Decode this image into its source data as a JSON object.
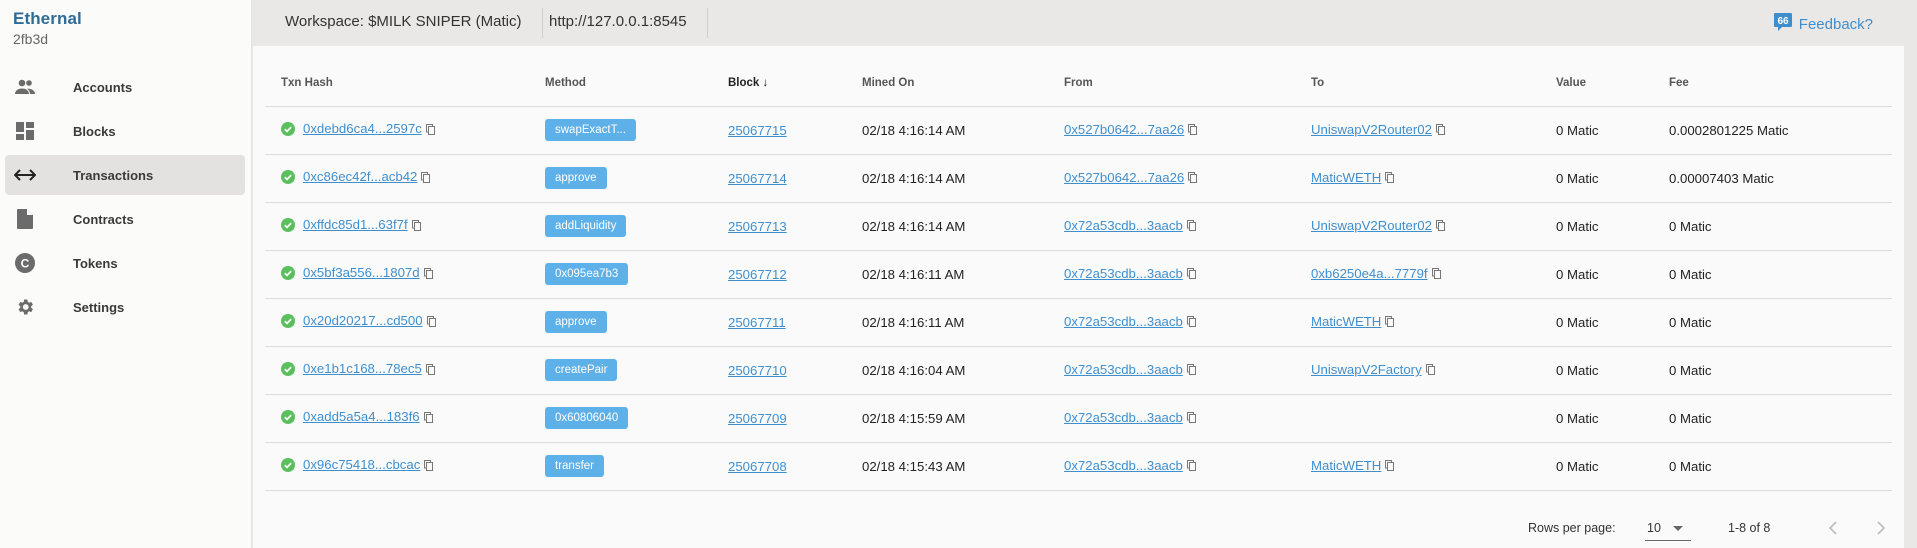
{
  "app": {
    "name": "Ethernal",
    "workspace_id": "2fb3d"
  },
  "sidebar": {
    "items": [
      {
        "label": "Accounts",
        "icon": "accounts-icon",
        "active": false
      },
      {
        "label": "Blocks",
        "icon": "blocks-icon",
        "active": false
      },
      {
        "label": "Transactions",
        "icon": "transactions-icon",
        "active": true
      },
      {
        "label": "Contracts",
        "icon": "contracts-icon",
        "active": false
      },
      {
        "label": "Tokens",
        "icon": "tokens-icon",
        "active": false
      },
      {
        "label": "Settings",
        "icon": "settings-icon",
        "active": false
      }
    ]
  },
  "topbar": {
    "workspace": "Workspace: $MILK SNIPER (Matic)",
    "rpc": "http://127.0.0.1:8545",
    "feedback": "Feedback?"
  },
  "table": {
    "headers": [
      "Txn Hash",
      "Method",
      "Block",
      "Mined On",
      "From",
      "To",
      "Value",
      "Fee"
    ],
    "sort_indicator": "↓",
    "rows": [
      {
        "hash": "0xdebd6ca4...2597c",
        "method": "swapExactT...",
        "block": "25067715",
        "mined": "02/18 4:16:14 AM",
        "from": "0x527b0642...7aa26",
        "to": "UniswapV2Router02",
        "value": "0 Matic",
        "fee": "0.0002801225 Matic"
      },
      {
        "hash": "0xc86ec42f...acb42",
        "method": "approve",
        "block": "25067714",
        "mined": "02/18 4:16:14 AM",
        "from": "0x527b0642...7aa26",
        "to": "MaticWETH",
        "value": "0 Matic",
        "fee": "0.00007403 Matic"
      },
      {
        "hash": "0xffdc85d1...63f7f",
        "method": "addLiquidity",
        "block": "25067713",
        "mined": "02/18 4:16:14 AM",
        "from": "0x72a53cdb...3aacb",
        "to": "UniswapV2Router02",
        "value": "0 Matic",
        "fee": "0 Matic"
      },
      {
        "hash": "0x5bf3a556...1807d",
        "method": "0x095ea7b3",
        "block": "25067712",
        "mined": "02/18 4:16:11 AM",
        "from": "0x72a53cdb...3aacb",
        "to": "0xb6250e4a...7779f",
        "value": "0 Matic",
        "fee": "0 Matic"
      },
      {
        "hash": "0x20d20217...cd500",
        "method": "approve",
        "block": "25067711",
        "mined": "02/18 4:16:11 AM",
        "from": "0x72a53cdb...3aacb",
        "to": "MaticWETH",
        "value": "0 Matic",
        "fee": "0 Matic"
      },
      {
        "hash": "0xe1b1c168...78ec5",
        "method": "createPair",
        "block": "25067710",
        "mined": "02/18 4:16:04 AM",
        "from": "0x72a53cdb...3aacb",
        "to": "UniswapV2Factory",
        "value": "0 Matic",
        "fee": "0 Matic"
      },
      {
        "hash": "0xadd5a5a4...183f6",
        "method": "0x60806040",
        "block": "25067709",
        "mined": "02/18 4:15:59 AM",
        "from": "0x72a53cdb...3aacb",
        "to": "",
        "value": "0 Matic",
        "fee": "0 Matic"
      },
      {
        "hash": "0x96c75418...cbcac",
        "method": "transfer",
        "block": "25067708",
        "mined": "02/18 4:15:43 AM",
        "from": "0x72a53cdb...3aacb",
        "to": "MaticWETH",
        "value": "0 Matic",
        "fee": "0 Matic"
      }
    ]
  },
  "pagination": {
    "rows_per_page_label": "Rows per page:",
    "rows_per_page": "10",
    "range": "1-8 of 8"
  },
  "colors": {
    "brand": "#2e6c99",
    "link": "#3f8fcf",
    "method_badge": "#5eb0e8",
    "success": "#5cbf5e"
  }
}
